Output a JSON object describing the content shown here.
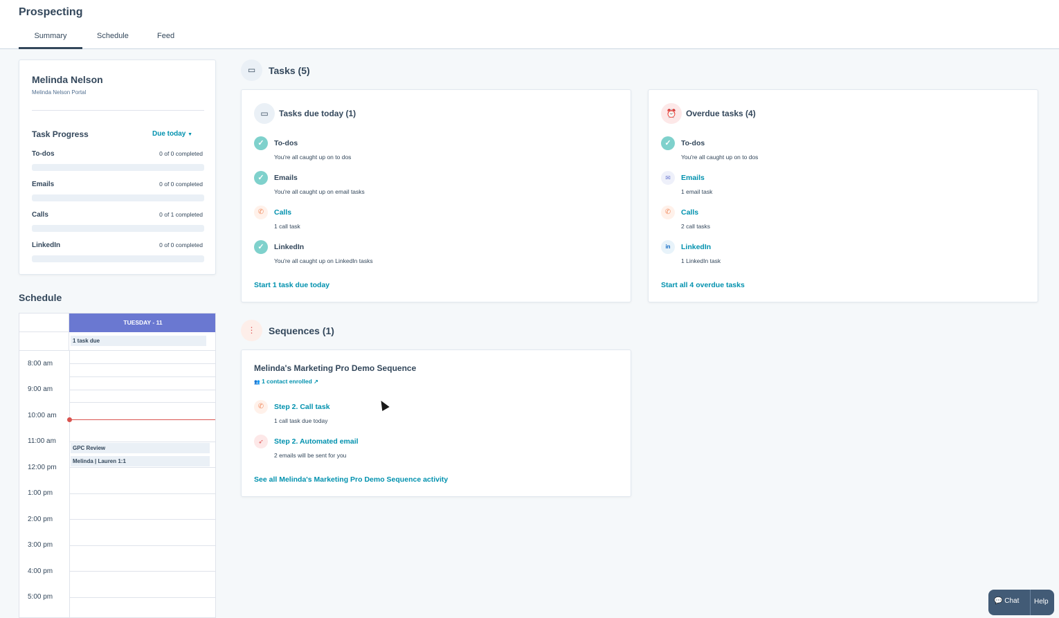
{
  "header": {
    "title": "Prospecting",
    "tabs": [
      {
        "label": "Summary",
        "active": true
      },
      {
        "label": "Schedule",
        "active": false
      },
      {
        "label": "Feed",
        "active": false
      }
    ]
  },
  "profile": {
    "name": "Melinda Nelson",
    "portal": "Melinda Nelson Portal"
  },
  "task_progress": {
    "title": "Task Progress",
    "filter": "Due today",
    "items": [
      {
        "label": "To-dos",
        "count": "0 of 0 completed"
      },
      {
        "label": "Emails",
        "count": "0 of 0 completed"
      },
      {
        "label": "Calls",
        "count": "0 of 1 completed"
      },
      {
        "label": "LinkedIn",
        "count": "0 of 0 completed"
      }
    ]
  },
  "schedule": {
    "title": "Schedule",
    "day_header": "TUESDAY - 11",
    "all_day": "1 task due",
    "hours": [
      "8:00 am",
      "9:00 am",
      "10:00 am",
      "11:00 am",
      "12:00 pm",
      "1:00 pm",
      "2:00 pm",
      "3:00 pm",
      "4:00 pm",
      "5:00 pm"
    ],
    "events": [
      "GPC Review",
      "Melinda | Lauren 1:1"
    ]
  },
  "tasks": {
    "title": "Tasks (5)",
    "due_today": {
      "title": "Tasks due today (1)",
      "items": [
        {
          "title": "To-dos",
          "sub": "You're all caught up on to dos"
        },
        {
          "title": "Emails",
          "sub": "You're all caught up on email tasks"
        },
        {
          "title": "Calls",
          "sub": "1 call task"
        },
        {
          "title": "LinkedIn",
          "sub": "You're all caught up on LinkedIn tasks"
        }
      ],
      "link": "Start 1 task due today"
    },
    "overdue": {
      "title": "Overdue tasks (4)",
      "items": [
        {
          "title": "To-dos",
          "sub": "You're all caught up on to dos"
        },
        {
          "title": "Emails",
          "sub": "1 email task"
        },
        {
          "title": "Calls",
          "sub": "2 call tasks"
        },
        {
          "title": "LinkedIn",
          "sub": "1 LinkedIn task"
        }
      ],
      "link": "Start all 4 overdue tasks"
    }
  },
  "sequences": {
    "title": "Sequences (1)",
    "name": "Melinda's Marketing Pro Demo Sequence",
    "enrolled": "1 contact enrolled",
    "steps": [
      {
        "title": "Step 2. Call task",
        "sub": "1 call task due today"
      },
      {
        "title": "Step 2. Automated email",
        "sub": "2 emails will be sent for you"
      }
    ],
    "link": "See all Melinda's Marketing Pro Demo Sequence activity"
  },
  "help_widget": {
    "chat": "Chat",
    "help": "Help"
  },
  "colors": {
    "accent": "#0091ae",
    "calendar_header": "#6a78d1",
    "now_indicator": "#d9534f",
    "check": "#7fd1cc"
  }
}
